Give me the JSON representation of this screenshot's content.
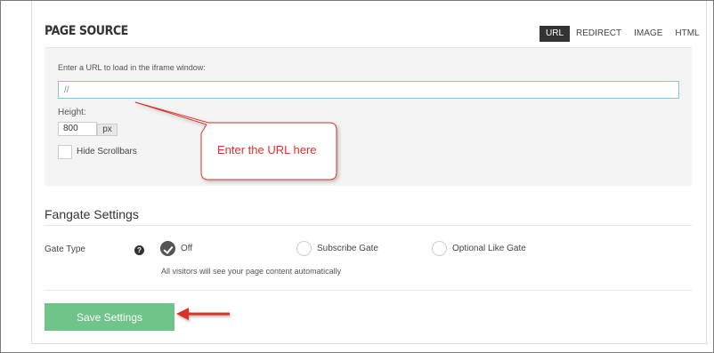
{
  "page_source": {
    "title": "PAGE SOURCE",
    "tabs": [
      {
        "label": "URL",
        "active": true
      },
      {
        "label": "REDIRECT",
        "active": false
      },
      {
        "label": "IMAGE",
        "active": false
      },
      {
        "label": "HTML",
        "active": false
      }
    ],
    "url_label": "Enter a URL to load in the iframe window:",
    "url_value": "//",
    "height_label": "Height:",
    "height_value": "800",
    "height_unit": "px",
    "hide_scrollbars_label": "Hide Scrollbars",
    "hide_scrollbars_checked": false
  },
  "callout": {
    "text": "Enter the URL here",
    "color": "#d9332c"
  },
  "fangate": {
    "title": "Fangate Settings",
    "gate_type_label": "Gate Type",
    "help_glyph": "?",
    "options": [
      {
        "label": "Off",
        "selected": true
      },
      {
        "label": "Subscribe Gate",
        "selected": false
      },
      {
        "label": "Optional Like Gate",
        "selected": false
      }
    ],
    "description": "All visitors will see your page content automatically"
  },
  "actions": {
    "save_label": "Save Settings",
    "save_color": "#6fc489",
    "arrow_color": "#d9332c"
  }
}
